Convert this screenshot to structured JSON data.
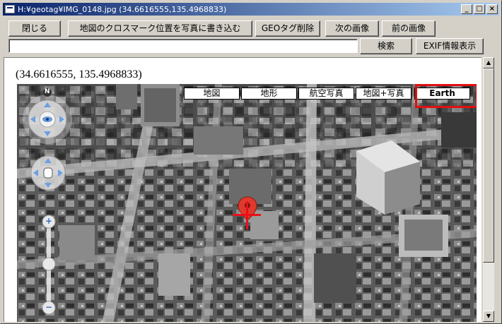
{
  "window": {
    "title": "H:¥geotag¥IMG_0148.jpg  (34.6616555,135.4968833)",
    "minimize": "_",
    "maximize": "□",
    "close": "×"
  },
  "toolbar": {
    "close_label": "閉じる",
    "write_label": "地図のクロスマーク位置を写真に書き込む",
    "geo_delete_label": "GEOタグ削除",
    "next_label": "次の画像",
    "prev_label": "前の画像",
    "search_label": "検索",
    "exif_label": "EXIF情報表示"
  },
  "search": {
    "value": ""
  },
  "coords_text": "(34.6616555, 135.4968833)",
  "map": {
    "compass_letter": "N",
    "map_types": [
      {
        "label": "地図",
        "active": false
      },
      {
        "label": "地形",
        "active": false
      },
      {
        "label": "航空写真",
        "active": false
      },
      {
        "label": "地図+写真",
        "active": false
      },
      {
        "label": "Earth",
        "active": true
      }
    ],
    "zoom_in": "+",
    "zoom_out": "−",
    "marker_color": "#e03a2c",
    "cross_color": "#e8101a",
    "highlight_color": "#e01010"
  },
  "scrollbar": {
    "up": "▲",
    "down": "▼"
  }
}
